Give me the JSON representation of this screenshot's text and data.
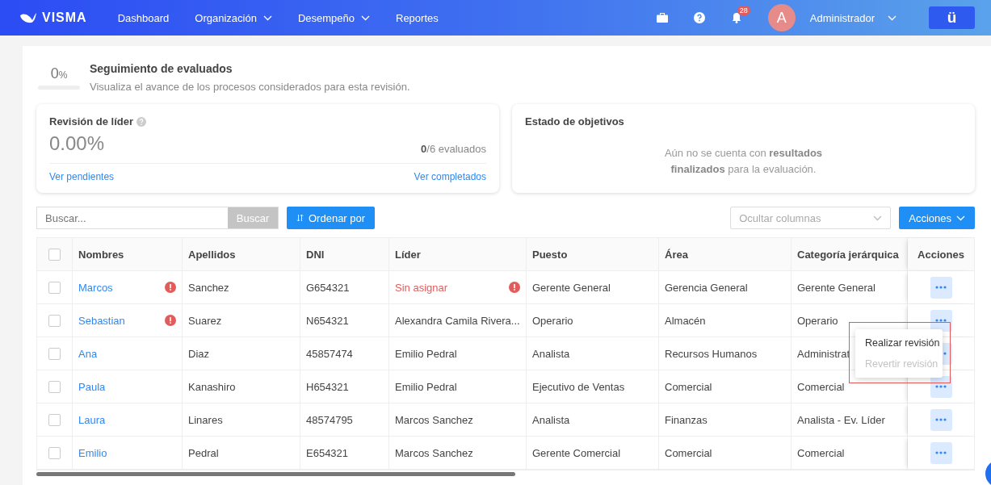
{
  "navbar": {
    "brand": "VISMA",
    "items": [
      {
        "label": "Dashboard",
        "has_menu": false
      },
      {
        "label": "Organización",
        "has_menu": true
      },
      {
        "label": "Desempeño",
        "has_menu": true
      },
      {
        "label": "Reportes",
        "has_menu": false
      }
    ],
    "notification_count": "28",
    "avatar_letter": "A",
    "user_name": "Administrador",
    "app_button": "ü"
  },
  "summary": {
    "percent": "0",
    "percent_sign": "%",
    "level": 0,
    "title": "Seguimiento de evaluados",
    "subtitle": "Visualiza el avance de los procesos considerados para esta revisión."
  },
  "leader_card": {
    "title": "Revisión de líder",
    "value": "0.00%",
    "count": "**0**/6 evaluados",
    "link_left": "Ver pendientes",
    "link_right": "Ver completados"
  },
  "objectives_card": {
    "title": "Estado de objetivos",
    "message": "Aún no se cuenta con **resultados**\n**finalizados** para la evaluación."
  },
  "toolbar": {
    "search_placeholder": "Buscar...",
    "search_button": "Buscar",
    "sort_button": "Ordenar por",
    "columns_placeholder": "Ocultar columnas",
    "actions_button": "Acciones"
  },
  "table": {
    "all_checked": false,
    "columns": [
      "Nombres",
      "Apellidos",
      "DNI",
      "Líder",
      "Puesto",
      "Área",
      "Categoría jerárquica",
      "Acciones"
    ],
    "rows": [
      {
        "checked": false,
        "nombres": "Marcos",
        "nombre_alert": true,
        "apellidos": "Sanchez",
        "dni": "G654321",
        "lider": "Sin asignar",
        "lider_alert": true,
        "puesto": "Gerente General",
        "area": "Gerencia General",
        "categoria": "Gerente General"
      },
      {
        "checked": false,
        "nombres": "Sebastian",
        "nombre_alert": true,
        "apellidos": "Suarez",
        "dni": "N654321",
        "lider": "Alexandra Camila Rivera...",
        "lider_alert": false,
        "puesto": "Operario",
        "area": "Almacén",
        "categoria": "Operario"
      },
      {
        "checked": false,
        "nombres": "Ana",
        "nombre_alert": false,
        "apellidos": "Diaz",
        "dni": "45857474",
        "lider": "Emilio Pedral",
        "lider_alert": false,
        "puesto": "Analista",
        "area": "Recursos Humanos",
        "categoria": "Administrat"
      },
      {
        "checked": false,
        "nombres": "Paula",
        "nombre_alert": false,
        "apellidos": "Kanashiro",
        "dni": "H654321",
        "lider": "Emilio Pedral",
        "lider_alert": false,
        "puesto": "Ejecutivo de Ventas",
        "area": "Comercial",
        "categoria": "Comercial"
      },
      {
        "checked": false,
        "nombres": "Laura",
        "nombre_alert": false,
        "apellidos": "Linares",
        "dni": "48574795",
        "lider": "Marcos Sanchez",
        "lider_alert": false,
        "puesto": "Analista",
        "area": "Finanzas",
        "categoria": "Analista - Ev. Líder"
      },
      {
        "checked": false,
        "nombres": "Emilio",
        "nombre_alert": false,
        "apellidos": "Pedral",
        "dni": "E654321",
        "lider": "Marcos Sanchez",
        "lider_alert": false,
        "puesto": "Gerente Comercial",
        "area": "Comercial",
        "categoria": "Comercial"
      }
    ]
  },
  "row_menu": {
    "items": [
      {
        "label": "Realizar revisión",
        "disabled": false
      },
      {
        "label": "Revertir revisión",
        "disabled": true
      }
    ]
  }
}
